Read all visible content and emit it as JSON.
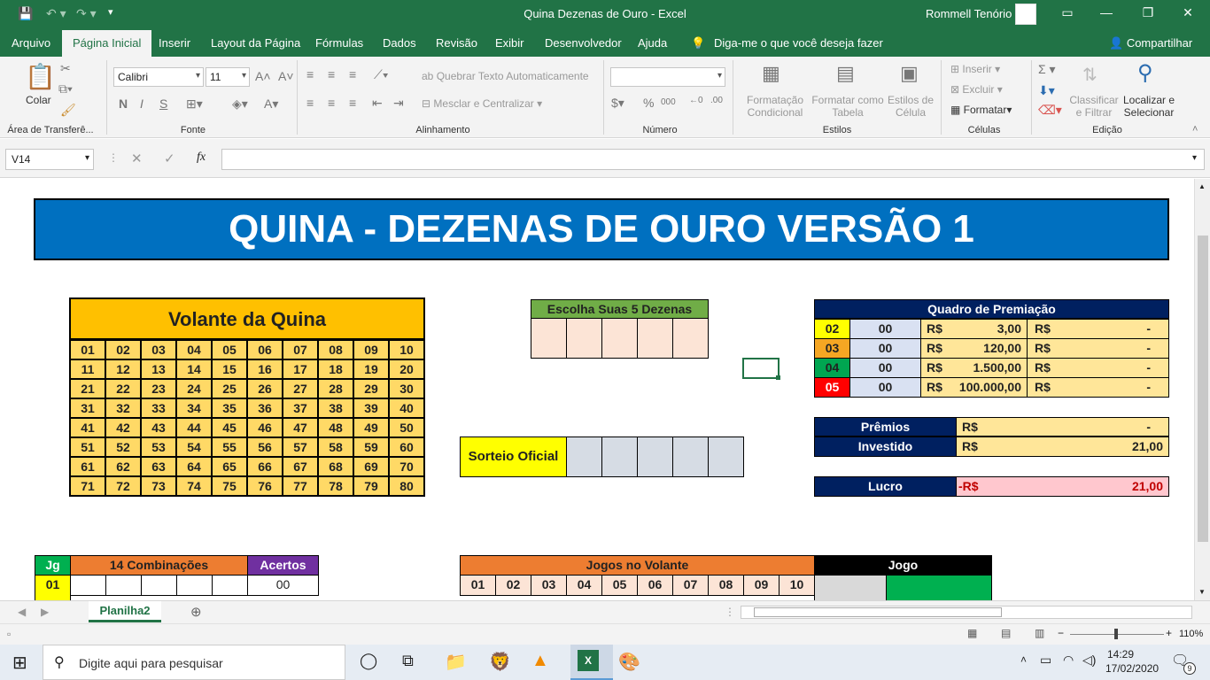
{
  "window": {
    "title": "Quina Dezenas de Ouro  -  Excel",
    "user": "Rommell Tenório"
  },
  "tabs": [
    "Arquivo",
    "Página Inicial",
    "Inserir",
    "Layout da Página",
    "Fórmulas",
    "Dados",
    "Revisão",
    "Exibir",
    "Desenvolvedor",
    "Ajuda"
  ],
  "tell_me": "Diga-me o que você deseja fazer",
  "share": "Compartilhar",
  "ribbon": {
    "paste": "Colar",
    "clipboard_group": "Área de Transferê...",
    "font_name": "Calibri",
    "font_size": "11",
    "font_group": "Fonte",
    "bold": "N",
    "italic": "I",
    "underline": "S",
    "wrap_text": "Quebrar Texto Automaticamente",
    "merge_center": "Mesclar e Centralizar",
    "alignment_group": "Alinhamento",
    "number_group": "Número",
    "percent": "%",
    "thousands": "000",
    "cond_format_1": "Formatação",
    "cond_format_2": "Condicional",
    "table_format_1": "Formatar como",
    "table_format_2": "Tabela",
    "cell_styles_1": "Estilos de",
    "cell_styles_2": "Célula",
    "styles_group": "Estilos",
    "insert": "Inserir",
    "delete": "Excluir",
    "format": "Formatar",
    "cells_group": "Células",
    "sort_1": "Classificar",
    "sort_2": "e Filtrar",
    "find_1": "Localizar e",
    "find_2": "Selecionar",
    "editing_group": "Edição"
  },
  "formula_bar": {
    "name_box": "V14",
    "fx": "fx",
    "value": ""
  },
  "sheet": {
    "banner": "QUINA - DEZENAS DE OURO VERSÃO 1",
    "volante_title": "Volante da Quina",
    "volante_numbers": [
      "01",
      "02",
      "03",
      "04",
      "05",
      "06",
      "07",
      "08",
      "09",
      "10",
      "11",
      "12",
      "13",
      "14",
      "15",
      "16",
      "17",
      "18",
      "19",
      "20",
      "21",
      "22",
      "23",
      "24",
      "25",
      "26",
      "27",
      "28",
      "29",
      "30",
      "31",
      "32",
      "33",
      "34",
      "35",
      "36",
      "37",
      "38",
      "39",
      "40",
      "41",
      "42",
      "43",
      "44",
      "45",
      "46",
      "47",
      "48",
      "49",
      "50",
      "51",
      "52",
      "53",
      "54",
      "55",
      "56",
      "57",
      "58",
      "59",
      "60",
      "61",
      "62",
      "63",
      "64",
      "65",
      "66",
      "67",
      "68",
      "69",
      "70",
      "71",
      "72",
      "73",
      "74",
      "75",
      "76",
      "77",
      "78",
      "79",
      "80"
    ],
    "escolha_title": "Escolha Suas 5 Dezenas",
    "sorteio_label": "Sorteio Oficial",
    "premiacao_title": "Quadro de Premiação",
    "premiacao_rows": [
      {
        "hits": "02",
        "count": "00",
        "cur1": "R$",
        "value": "3,00",
        "cur2": "R$",
        "total": "-",
        "color": "#ffff00"
      },
      {
        "hits": "03",
        "count": "00",
        "cur1": "R$",
        "value": "120,00",
        "cur2": "R$",
        "total": "-",
        "color": "#f5a623"
      },
      {
        "hits": "04",
        "count": "00",
        "cur1": "R$",
        "value": "1.500,00",
        "cur2": "R$",
        "total": "-",
        "color": "#00a651"
      },
      {
        "hits": "05",
        "count": "00",
        "cur1": "R$",
        "value": "100.000,00",
        "cur2": "R$",
        "total": "-",
        "color": "#ff0000"
      }
    ],
    "premios_label": "Prêmios",
    "premios_cur": "R$",
    "premios_value": "-",
    "investido_label": "Investido",
    "investido_cur": "R$",
    "investido_value": "21,00",
    "lucro_label": "Lucro",
    "lucro_cur": "-R$",
    "lucro_value": "21,00",
    "jg_header": "Jg",
    "comb_header": "14 Combinações",
    "acertos_header": "Acertos",
    "jg_first": "01",
    "acertos_first": "00",
    "jogos_header": "Jogos no Volante",
    "jogos_numbers": [
      "01",
      "02",
      "03",
      "04",
      "05",
      "06",
      "07",
      "08",
      "09",
      "10"
    ],
    "jogo_header": "Jogo"
  },
  "sheet_tab": "Planilha2",
  "zoom": "110%",
  "taskbar": {
    "search": "Digite aqui para pesquisar",
    "time": "14:29",
    "date": "17/02/2020",
    "notif": "9"
  }
}
